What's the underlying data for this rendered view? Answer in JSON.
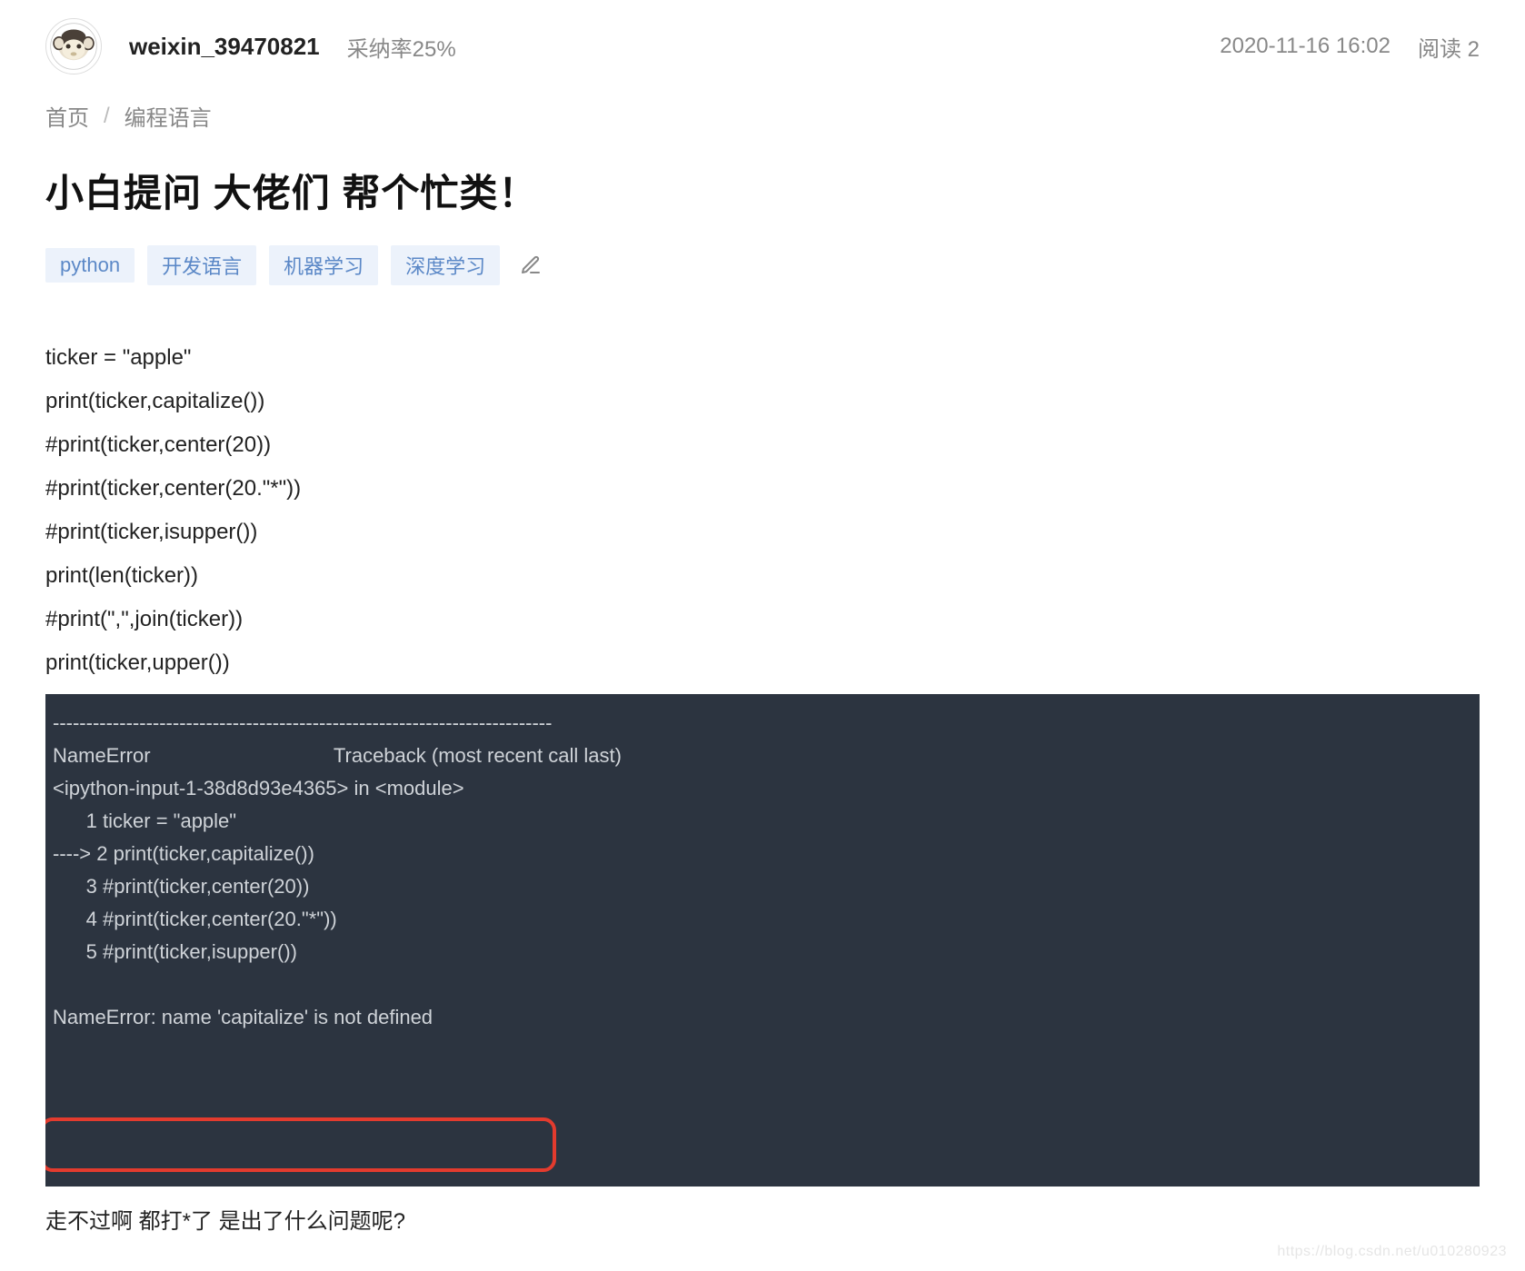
{
  "header": {
    "username": "weixin_39470821",
    "accept_rate": "采纳率25%",
    "timestamp": "2020-11-16 16:02",
    "reads_label": "阅读 2"
  },
  "breadcrumb": {
    "home": "首页",
    "category": "编程语言"
  },
  "title": "小白提问 大佬们 帮个忙类！",
  "tags": [
    "python",
    "开发语言",
    "机器学习",
    "深度学习"
  ],
  "body": {
    "code_lines": [
      "ticker = \"apple\"",
      "print(ticker,capitalize())",
      "#print(ticker,center(20))",
      "#print(ticker,center(20.\"*\"))",
      "#print(ticker,isupper())",
      "print(len(ticker))",
      "#print(\",\",join(ticker))",
      "print(ticker,upper())"
    ],
    "error_lines": [
      "---------------------------------------------------------------------------",
      "NameError                                 Traceback (most recent call last)",
      "<ipython-input-1-38d8d93e4365> in <module>",
      "      1 ticker = \"apple\"",
      "----> 2 print(ticker,capitalize())",
      "      3 #print(ticker,center(20))",
      "      4 #print(ticker,center(20.\"*\"))",
      "      5 #print(ticker,isupper())",
      "",
      "NameError: name 'capitalize' is not defined"
    ],
    "question": "走不过啊 都打*了  是出了什么问题呢?"
  },
  "watermark": "https://blog.csdn.net/u010280923"
}
